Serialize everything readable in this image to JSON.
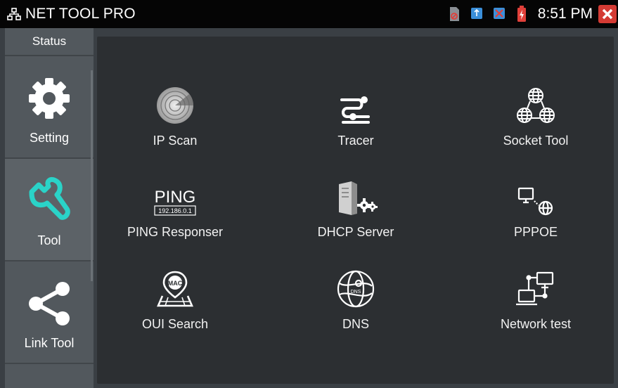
{
  "topbar": {
    "app_icon": "network-icon",
    "title": "NET TOOL PRO",
    "time": "8:51 PM",
    "status_icons": [
      "sd-card-icon",
      "usb-icon",
      "network-disconnected-icon",
      "battery-charging-icon"
    ],
    "close_icon": "close-icon"
  },
  "sidebar": {
    "status_label": "Status",
    "items": [
      {
        "label": "Setting",
        "icon": "gear-icon"
      },
      {
        "label": "Tool",
        "icon": "wrench-icon",
        "active": true,
        "icon_color": "#2ad3c8"
      },
      {
        "label": "Link Tool",
        "icon": "share-icon"
      }
    ]
  },
  "tools": [
    {
      "label": "IP Scan",
      "icon": "radar-icon"
    },
    {
      "label": "Tracer",
      "icon": "tracer-icon"
    },
    {
      "label": "Socket Tool",
      "icon": "globes-network-icon"
    },
    {
      "label": "PING Responser",
      "icon": "ping-icon",
      "icon_text": "PING",
      "icon_subtext": "192.186.0.1"
    },
    {
      "label": "DHCP Server",
      "icon": "server-gears-icon"
    },
    {
      "label": "PPPOE",
      "icon": "computer-globe-icon"
    },
    {
      "label": "OUI Search",
      "icon": "mac-location-icon",
      "icon_text": "MAC"
    },
    {
      "label": "DNS",
      "icon": "dns-globe-icon",
      "icon_text": "DNS"
    },
    {
      "label": "Network test",
      "icon": "network-test-icon"
    }
  ],
  "colors": {
    "accent": "#2ad3c8",
    "close": "#d43b34",
    "background": "#2c2f32",
    "sidebar": "#52585d"
  }
}
